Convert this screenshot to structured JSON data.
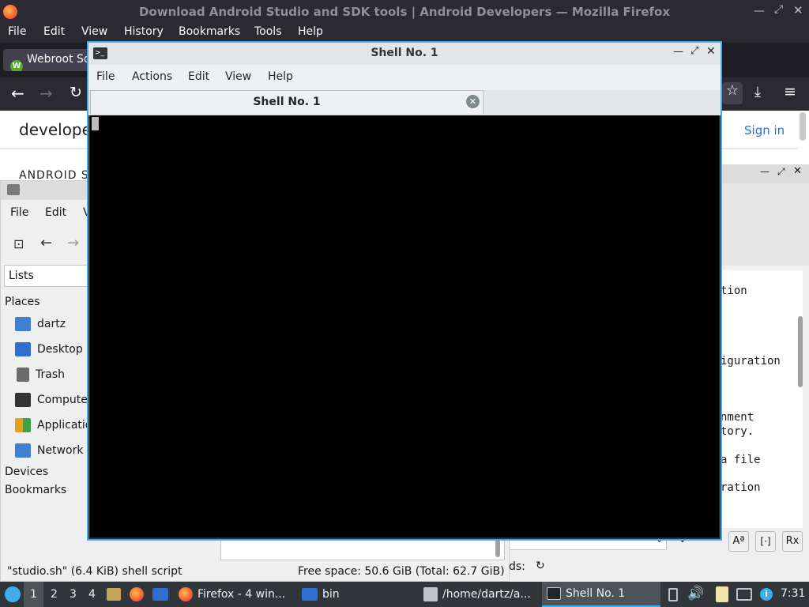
{
  "firefox": {
    "window_title": "Download Android Studio and SDK tools  |  Android Developers — Mozilla Firefox",
    "menu": [
      "File",
      "Edit",
      "View",
      "History",
      "Bookmarks",
      "Tools",
      "Help"
    ],
    "tab_label": "Webroot So",
    "page_logo_text": "develope",
    "sign_in": "Sign in",
    "page_partial_heading": "ANDROID S"
  },
  "file_manager": {
    "menu": [
      "File",
      "Edit",
      "V"
    ],
    "view_selector": "Lists",
    "places_header": "Places",
    "places": [
      {
        "label": "dartz",
        "icon": "home-folder-icon",
        "color": "#3f7fd6"
      },
      {
        "label": "Desktop",
        "icon": "desktop-icon",
        "color": "#2f6fd0"
      },
      {
        "label": "Trash",
        "icon": "trash-icon",
        "color": "#6b6b6b"
      },
      {
        "label": "Compute",
        "icon": "computer-icon",
        "color": "#333333"
      },
      {
        "label": "Applicatio",
        "icon": "applications-icon",
        "color": "#e0a020"
      },
      {
        "label": "Network",
        "icon": "network-icon",
        "color": "#3f7fd6"
      }
    ],
    "devices_header": "Devices",
    "bookmarks_header": "Bookmarks",
    "status_file": "\"studio.sh\" (6.4 KiB) shell script",
    "status_space": "Free space: 50.6 GiB (Total: 62.7 GiB)"
  },
  "right_panel": {
    "code_lines": [
      "tion",
      "iguration",
      "nment",
      "tory.",
      "a file",
      "ration"
    ],
    "find_label": "ds:"
  },
  "shell": {
    "title": "Shell No. 1",
    "menu": [
      "File",
      "Actions",
      "Edit",
      "View",
      "Help"
    ],
    "tab_label": "Shell No. 1"
  },
  "taskbar": {
    "workspaces": [
      "1",
      "2",
      "3",
      "4"
    ],
    "tasks": [
      "Firefox - 4 win...",
      "bin",
      "/home/dartz/a...",
      "Shell No. 1"
    ],
    "clock": "7:31"
  }
}
